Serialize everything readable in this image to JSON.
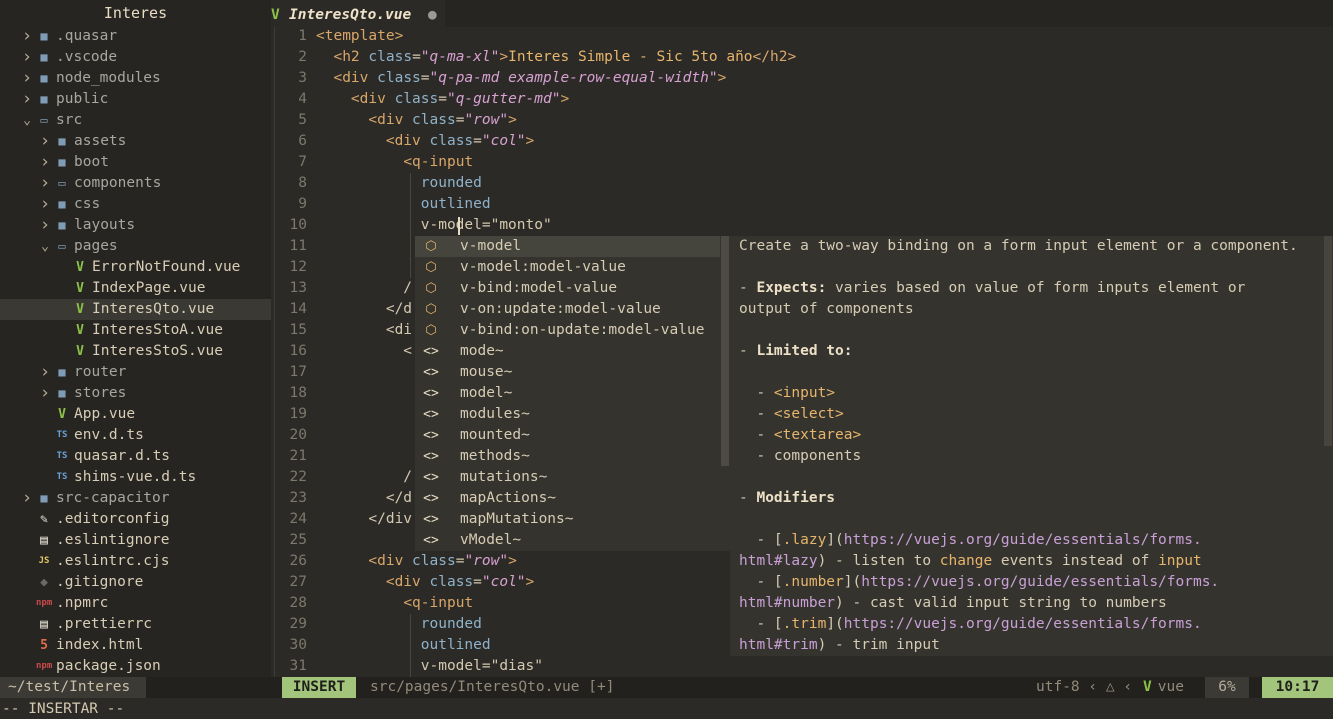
{
  "explorer": {
    "title": "Interes",
    "items": [
      {
        "name": ".quasar",
        "type": "folder",
        "state": "closed",
        "depth": 0
      },
      {
        "name": ".vscode",
        "type": "folder",
        "state": "closed",
        "depth": 0
      },
      {
        "name": "node_modules",
        "type": "folder",
        "state": "closed",
        "depth": 0
      },
      {
        "name": "public",
        "type": "folder",
        "state": "closed",
        "depth": 0
      },
      {
        "name": "src",
        "type": "folder",
        "state": "open",
        "depth": 0
      },
      {
        "name": "assets",
        "type": "folder",
        "state": "closed",
        "depth": 1
      },
      {
        "name": "boot",
        "type": "folder",
        "state": "closed",
        "depth": 1
      },
      {
        "name": "components",
        "type": "folder",
        "state": "closed-empty",
        "depth": 1
      },
      {
        "name": "css",
        "type": "folder",
        "state": "closed",
        "depth": 1
      },
      {
        "name": "layouts",
        "type": "folder",
        "state": "closed",
        "depth": 1
      },
      {
        "name": "pages",
        "type": "folder",
        "state": "open",
        "depth": 1
      },
      {
        "name": "ErrorNotFound.vue",
        "type": "vue",
        "depth": 2
      },
      {
        "name": "IndexPage.vue",
        "type": "vue",
        "depth": 2
      },
      {
        "name": "InteresQto.vue",
        "type": "vue",
        "depth": 2,
        "selected": true
      },
      {
        "name": "InteresStoA.vue",
        "type": "vue",
        "depth": 2
      },
      {
        "name": "InteresStoS.vue",
        "type": "vue",
        "depth": 2
      },
      {
        "name": "router",
        "type": "folder",
        "state": "closed",
        "depth": 1
      },
      {
        "name": "stores",
        "type": "folder",
        "state": "closed",
        "depth": 1
      },
      {
        "name": "App.vue",
        "type": "vue",
        "depth": 1
      },
      {
        "name": "env.d.ts",
        "type": "ts",
        "depth": 1
      },
      {
        "name": "quasar.d.ts",
        "type": "ts",
        "depth": 1
      },
      {
        "name": "shims-vue.d.ts",
        "type": "ts",
        "depth": 1
      },
      {
        "name": "src-capacitor",
        "type": "folder",
        "state": "closed",
        "depth": 0
      },
      {
        "name": ".editorconfig",
        "type": "editorconfig",
        "depth": 0
      },
      {
        "name": ".eslintignore",
        "type": "text",
        "depth": 0
      },
      {
        "name": ".eslintrc.cjs",
        "type": "js",
        "depth": 0
      },
      {
        "name": ".gitignore",
        "type": "git",
        "depth": 0
      },
      {
        "name": ".npmrc",
        "type": "npm",
        "depth": 0
      },
      {
        "name": ".prettierrc",
        "type": "text",
        "depth": 0
      },
      {
        "name": "index.html",
        "type": "html",
        "depth": 0
      },
      {
        "name": "package.json",
        "type": "npm",
        "depth": 0
      }
    ]
  },
  "tab": {
    "name": "InteresQto.vue",
    "modified_marker": "●"
  },
  "editor": {
    "lines": [
      {
        "n": "1",
        "html": "<span class='tg'>&lt;template&gt;</span>"
      },
      {
        "n": "2",
        "html": "  <span class='tg'>&lt;h2</span> <span class='at'>class</span>=<span class='st'>\"q-ma-xl\"</span><span class='tg'>&gt;</span><span class='ctext'>Interes Simple - Sic 5to año</span><span class='tg'>&lt;/h2&gt;</span>"
      },
      {
        "n": "3",
        "html": "  <span class='tg'>&lt;div</span> <span class='at'>class</span>=<span class='st'>\"q-pa-md example-row-equal-width\"</span><span class='tg'>&gt;</span>"
      },
      {
        "n": "4",
        "html": "    <span class='tg'>&lt;div</span> <span class='at'>class</span>=<span class='st'>\"q-gutter-md\"</span><span class='tg'>&gt;</span>"
      },
      {
        "n": "5",
        "html": "      <span class='tg'>&lt;div</span> <span class='at'>class</span>=<span class='st'>\"row\"</span><span class='tg'>&gt;</span>"
      },
      {
        "n": "6",
        "html": "        <span class='tg'>&lt;div</span> <span class='at'>class</span>=<span class='st'>\"col\"</span><span class='tg'>&gt;</span>"
      },
      {
        "n": "7",
        "html": "          <span class='tg'>&lt;q-input</span>"
      },
      {
        "n": "8",
        "html": "            <span class='at'>rounded</span>"
      },
      {
        "n": "9",
        "html": "            <span class='at'>outlined</span>"
      },
      {
        "n": "10",
        "html": "            v-model=\"monto\""
      },
      {
        "n": "11",
        "html": ""
      },
      {
        "n": "12",
        "html": ""
      },
      {
        "n": "13",
        "html": "          /"
      },
      {
        "n": "14",
        "html": "        &lt;/d"
      },
      {
        "n": "15",
        "html": "        &lt;di"
      },
      {
        "n": "16",
        "html": "          &lt;"
      },
      {
        "n": "17",
        "html": ""
      },
      {
        "n": "18",
        "html": ""
      },
      {
        "n": "19",
        "html": ""
      },
      {
        "n": "20",
        "html": ""
      },
      {
        "n": "21",
        "html": ""
      },
      {
        "n": "22",
        "html": "          /"
      },
      {
        "n": "23",
        "html": "        &lt;/d"
      },
      {
        "n": "24",
        "html": "      &lt;/div"
      },
      {
        "n": "25",
        "html": ""
      },
      {
        "n": "26",
        "html": "      <span class='tg'>&lt;div</span> <span class='at'>class</span>=<span class='st'>\"row\"</span><span class='tg'>&gt;</span>"
      },
      {
        "n": "27",
        "html": "        <span class='tg'>&lt;div</span> <span class='at'>class</span>=<span class='st'>\"col\"</span><span class='tg'>&gt;</span>"
      },
      {
        "n": "28",
        "html": "          <span class='tg'>&lt;q-input</span>"
      },
      {
        "n": "29",
        "html": "            <span class='at'>rounded</span>"
      },
      {
        "n": "30",
        "html": "            <span class='at'>outlined</span>"
      },
      {
        "n": "31",
        "html": "            v-model=\"dias\""
      }
    ]
  },
  "completion": {
    "items": [
      {
        "icon": "cube",
        "label": "v-model",
        "selected": true
      },
      {
        "icon": "cube",
        "label": "v-model:model-value"
      },
      {
        "icon": "cube",
        "label": "v-bind:model-value"
      },
      {
        "icon": "cube",
        "label": "v-on:update:model-value"
      },
      {
        "icon": "cube",
        "label": "v-bind:on-update:model-value"
      },
      {
        "icon": "snippet",
        "label": "mode~"
      },
      {
        "icon": "snippet",
        "label": "mouse~"
      },
      {
        "icon": "snippet",
        "label": "model~"
      },
      {
        "icon": "snippet",
        "label": "modules~"
      },
      {
        "icon": "snippet",
        "label": "mounted~"
      },
      {
        "icon": "snippet",
        "label": "methods~"
      },
      {
        "icon": "snippet",
        "label": "mutations~"
      },
      {
        "icon": "snippet",
        "label": "mapActions~"
      },
      {
        "icon": "snippet",
        "label": "mapMutations~"
      },
      {
        "icon": "snippet",
        "label": "vModel~"
      }
    ]
  },
  "doc": {
    "lines": [
      "Create a two-way binding on a form input element or a component.",
      "",
      "- <b>Expects:</b> varies based on value of form inputs element or",
      "output of components",
      "",
      "- <b>Limited to:</b>",
      "",
      "  - <span class='dorange'>&lt;input&gt;</span>",
      "  - <span class='dorange'>&lt;select&gt;</span>",
      "  - <span class='dorange'>&lt;textarea&gt;</span>",
      "  - components",
      "",
      "- <b>Modifiers</b>",
      "",
      "  - [<span class='dorange'>.lazy</span>](<span class='dpurple'>https://vuejs.org/guide/essentials/forms.</span>",
      "<span class='dpurple'>html#lazy</span>) - listen to <span class='dorange'>change</span> events instead of <span class='dorange'>input</span>",
      "  - [<span class='dorange'>.number</span>](<span class='dpurple'>https://vuejs.org/guide/essentials/forms.</span>",
      "<span class='dpurple'>html#number</span>) - cast valid input string to numbers",
      "  - [<span class='dorange'>.trim</span>](<span class='dpurple'>https://vuejs.org/guide/essentials/forms.</span>",
      "<span class='dpurple'>html#trim</span>) - trim input"
    ]
  },
  "statusline": {
    "cwd": "~/test/Interes",
    "mode": "INSERT",
    "file": "src/pages/InteresQto.vue [+]",
    "encoding": "utf-8",
    "filetype": "vue",
    "percent": "6%",
    "time": "10:17"
  },
  "cmdline": "-- INSERTAR --",
  "colors": {
    "accent_green": "#a3c47b",
    "vue_green": "#8dc149",
    "folder": "#7f9bb5",
    "ts_blue": "#6aa2d8"
  }
}
